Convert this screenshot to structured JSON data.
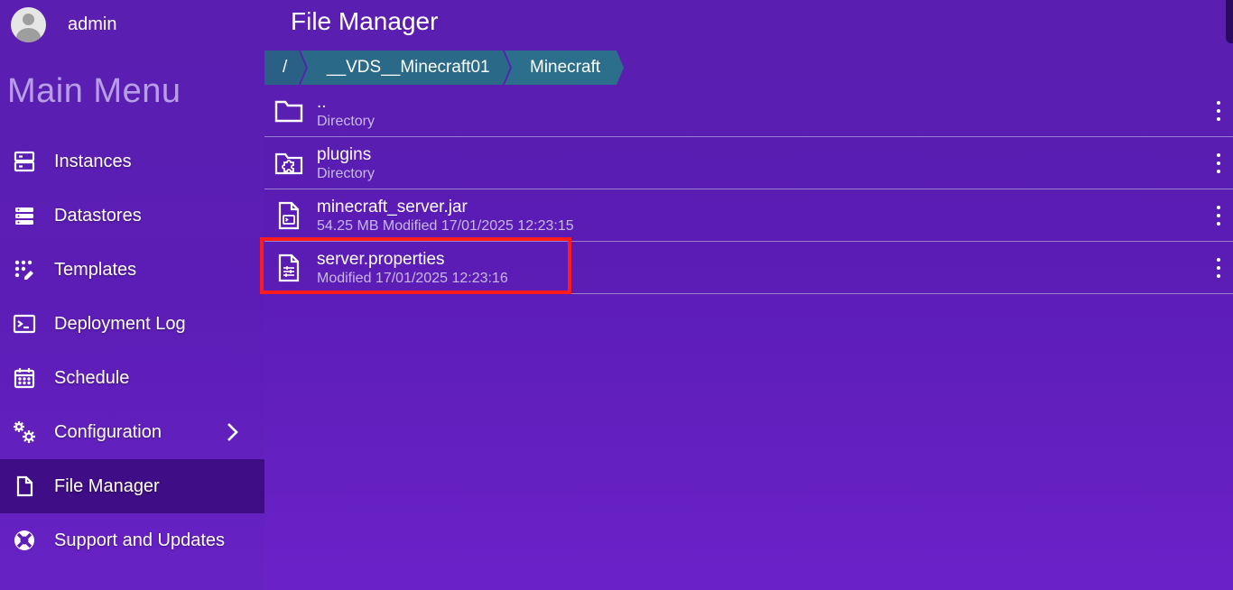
{
  "user": {
    "name": "admin"
  },
  "sidebar": {
    "title": "Main Menu",
    "items": [
      {
        "label": "Instances",
        "icon": "server-icon"
      },
      {
        "label": "Datastores",
        "icon": "database-icon"
      },
      {
        "label": "Templates",
        "icon": "templates-icon"
      },
      {
        "label": "Deployment Log",
        "icon": "terminal-icon"
      },
      {
        "label": "Schedule",
        "icon": "calendar-icon"
      },
      {
        "label": "Configuration",
        "icon": "gears-icon"
      },
      {
        "label": "File Manager",
        "icon": "file-icon",
        "active": true
      },
      {
        "label": "Support and Updates",
        "icon": "lifebuoy-icon"
      }
    ]
  },
  "page": {
    "title": "File Manager"
  },
  "breadcrumb": [
    "/",
    "__VDS__Minecraft01",
    "Minecraft"
  ],
  "files": [
    {
      "name": "..",
      "meta": "Directory",
      "icon": "folder-icon"
    },
    {
      "name": "plugins",
      "meta": "Directory",
      "icon": "plugin-folder-icon"
    },
    {
      "name": "minecraft_server.jar",
      "meta": "54.25 MB Modified 17/01/2025 12:23:15",
      "icon": "jar-file-icon"
    },
    {
      "name": "server.properties",
      "meta": "Modified 17/01/2025 12:23:16",
      "icon": "properties-file-icon"
    }
  ],
  "colors": {
    "background": "#5a1fb0",
    "active_menu": "#3f0d86",
    "breadcrumb": "#2a6a88",
    "highlight": "#ff1b1b"
  }
}
